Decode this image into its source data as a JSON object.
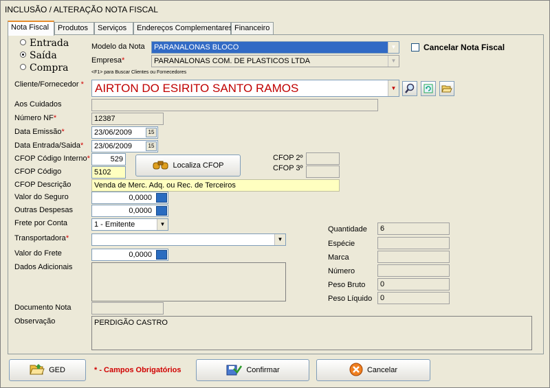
{
  "window": {
    "title": "INCLUSÃO / ALTERAÇÃO NOTA FISCAL"
  },
  "tabs": [
    {
      "label": "Nota Fiscal",
      "active": true
    },
    {
      "label": "Produtos"
    },
    {
      "label": "Serviços"
    },
    {
      "label": "Endereços Complementares"
    },
    {
      "label": "Financeiro"
    }
  ],
  "radios": [
    {
      "label": "Entrada",
      "checked": false
    },
    {
      "label": "Saída",
      "checked": true
    },
    {
      "label": "Compra",
      "checked": false
    }
  ],
  "modelo": {
    "label": "Modelo da Nota",
    "value": "PARANALONAS BLOCO"
  },
  "empresa": {
    "label": "Empresa",
    "required": "*",
    "value": "PARANALONAS COM. DE PLASTICOS LTDA"
  },
  "cancelar_nf": {
    "label": "Cancelar Nota Fiscal",
    "checked": false
  },
  "hint": "<F1> para Buscar Clientes ou Fornecedores",
  "cliente": {
    "label": "Cliente/Fornecedor",
    "required": "*",
    "value": "AIRTON DO ESIRITO SANTO RAMOS"
  },
  "aos_cuidados": {
    "label": "Aos Cuidados",
    "value": ""
  },
  "numero_nf": {
    "label": "Número NF",
    "required": "*",
    "value": "12387"
  },
  "data_emissao": {
    "label": "Data Emissão",
    "required": "*",
    "value": "23/06/2009"
  },
  "data_entrada": {
    "label": "Data Entrada/Saida",
    "required": "*",
    "value": "23/06/2009"
  },
  "cfop_interno": {
    "label": "CFOP Código Interno",
    "required": "*",
    "value": "529"
  },
  "cfop_codigo": {
    "label": "CFOP Código",
    "value": "5102"
  },
  "localiza_cfop": {
    "label": "Localiza CFOP"
  },
  "cfop2": {
    "label": "CFOP 2º",
    "value": ""
  },
  "cfop3": {
    "label": "CFOP 3º",
    "value": ""
  },
  "cfop_descricao": {
    "label": "CFOP Descrição",
    "value": "Venda de Merc. Adq. ou Rec. de Terceiros"
  },
  "valor_seguro": {
    "label": "Valor do Seguro",
    "value": "0,0000"
  },
  "outras_despesas": {
    "label": "Outras Despesas",
    "value": "0,0000"
  },
  "frete_conta": {
    "label": "Frete por Conta",
    "value": "1 - Emitente"
  },
  "transportadora": {
    "label": "Transportadora",
    "required": "*",
    "value": ""
  },
  "valor_frete": {
    "label": "Valor do Frete",
    "value": "0,0000"
  },
  "dados_adicionais": {
    "label": "Dados Adicionais",
    "value": ""
  },
  "documento_nota": {
    "label": "Documento Nota",
    "value": ""
  },
  "observacao": {
    "label": "Observação",
    "value": "PERDIGÃO CASTRO"
  },
  "volumes": {
    "quantidade": {
      "label": "Quantidade",
      "value": "6"
    },
    "especie": {
      "label": "Espécie",
      "value": ""
    },
    "marca": {
      "label": "Marca",
      "value": ""
    },
    "numero": {
      "label": "Número",
      "value": ""
    },
    "peso_bruto": {
      "label": "Peso Bruto",
      "value": "0"
    },
    "peso_liquido": {
      "label": "Peso Líquido",
      "value": "0"
    }
  },
  "footer": {
    "ged": "GED",
    "required_note": "* - Campos Obrigatórios",
    "confirmar": "Confirmar",
    "cancelar": "Cancelar"
  },
  "colors": {
    "required": "#d00000",
    "selection": "#316ac5",
    "highlight": "#ffffc0",
    "client_text": "#c00000"
  }
}
